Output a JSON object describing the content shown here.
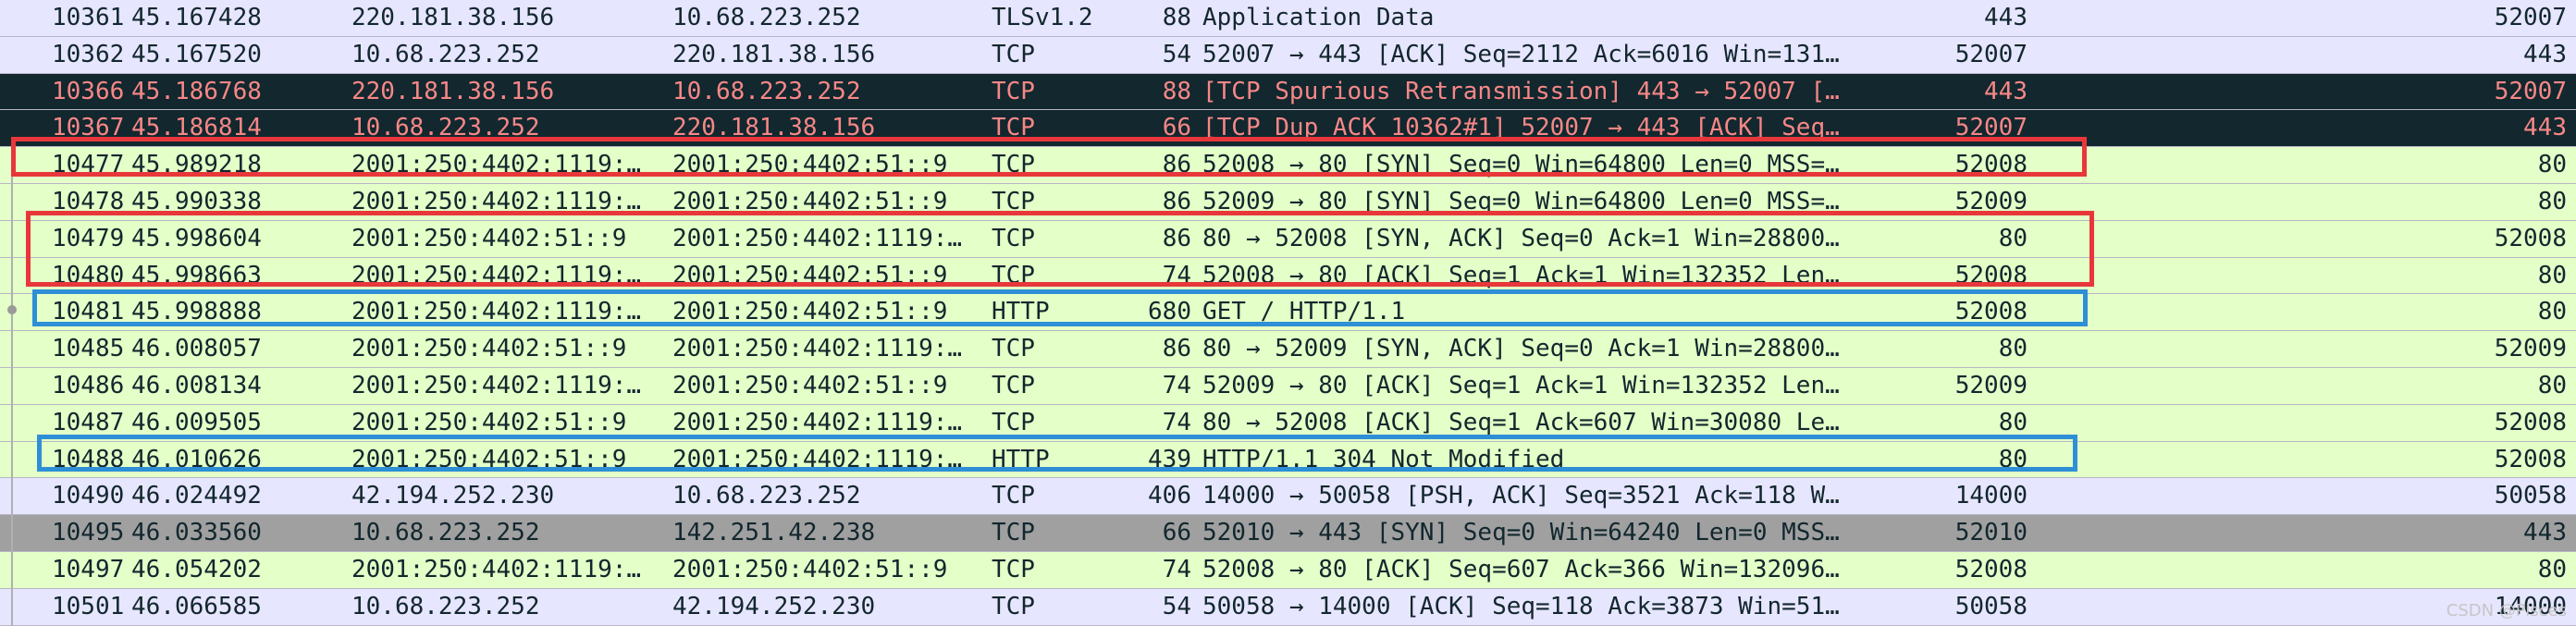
{
  "packets": [
    {
      "no": "10361",
      "time": "45.167428",
      "src": "220.181.38.156",
      "dst": "10.68.223.252",
      "proto": "TLSv1.2",
      "len": "88",
      "info": "Application Data",
      "sport": "443",
      "dport": "52007",
      "style": "tls"
    },
    {
      "no": "10362",
      "time": "45.167520",
      "src": "10.68.223.252",
      "dst": "220.181.38.156",
      "proto": "TCP",
      "len": "54",
      "info": "52007 → 443 [ACK] Seq=2112 Ack=6016 Win=131…",
      "sport": "52007",
      "dport": "443",
      "style": "tcp"
    },
    {
      "no": "10366",
      "time": "45.186768",
      "src": "220.181.38.156",
      "dst": "10.68.223.252",
      "proto": "TCP",
      "len": "88",
      "info": "[TCP Spurious Retransmission] 443 → 52007 […",
      "sport": "443",
      "dport": "52007",
      "style": "bad"
    },
    {
      "no": "10367",
      "time": "45.186814",
      "src": "10.68.223.252",
      "dst": "220.181.38.156",
      "proto": "TCP",
      "len": "66",
      "info": "[TCP Dup ACK 10362#1] 52007 → 443 [ACK] Seq…",
      "sport": "52007",
      "dport": "443",
      "style": "bad"
    },
    {
      "no": "10477",
      "time": "45.989218",
      "src": "2001:250:4402:1119:…",
      "dst": "2001:250:4402:51::9",
      "proto": "TCP",
      "len": "86",
      "info": "52008 → 80 [SYN] Seq=0 Win=64800 Len=0 MSS=…",
      "sport": "52008",
      "dport": "80",
      "style": "http"
    },
    {
      "no": "10478",
      "time": "45.990338",
      "src": "2001:250:4402:1119:…",
      "dst": "2001:250:4402:51::9",
      "proto": "TCP",
      "len": "86",
      "info": "52009 → 80 [SYN] Seq=0 Win=64800 Len=0 MSS=…",
      "sport": "52009",
      "dport": "80",
      "style": "http"
    },
    {
      "no": "10479",
      "time": "45.998604",
      "src": "2001:250:4402:51::9",
      "dst": "2001:250:4402:1119:…",
      "proto": "TCP",
      "len": "86",
      "info": "80 → 52008 [SYN, ACK] Seq=0 Ack=1 Win=28800…",
      "sport": "80",
      "dport": "52008",
      "style": "http"
    },
    {
      "no": "10480",
      "time": "45.998663",
      "src": "2001:250:4402:1119:…",
      "dst": "2001:250:4402:51::9",
      "proto": "TCP",
      "len": "74",
      "info": "52008 → 80 [ACK] Seq=1 Ack=1 Win=132352 Len…",
      "sport": "52008",
      "dport": "80",
      "style": "http"
    },
    {
      "no": "10481",
      "time": "45.998888",
      "src": "2001:250:4402:1119:…",
      "dst": "2001:250:4402:51::9",
      "proto": "HTTP",
      "len": "680",
      "info": "GET / HTTP/1.1",
      "sport": "52008",
      "dport": "80",
      "style": "http"
    },
    {
      "no": "10485",
      "time": "46.008057",
      "src": "2001:250:4402:51::9",
      "dst": "2001:250:4402:1119:…",
      "proto": "TCP",
      "len": "86",
      "info": "80 → 52009 [SYN, ACK] Seq=0 Ack=1 Win=28800…",
      "sport": "80",
      "dport": "52009",
      "style": "http"
    },
    {
      "no": "10486",
      "time": "46.008134",
      "src": "2001:250:4402:1119:…",
      "dst": "2001:250:4402:51::9",
      "proto": "TCP",
      "len": "74",
      "info": "52009 → 80 [ACK] Seq=1 Ack=1 Win=132352 Len…",
      "sport": "52009",
      "dport": "80",
      "style": "http"
    },
    {
      "no": "10487",
      "time": "46.009505",
      "src": "2001:250:4402:51::9",
      "dst": "2001:250:4402:1119:…",
      "proto": "TCP",
      "len": "74",
      "info": "80 → 52008 [ACK] Seq=1 Ack=607 Win=30080 Le…",
      "sport": "80",
      "dport": "52008",
      "style": "http"
    },
    {
      "no": "10488",
      "time": "46.010626",
      "src": "2001:250:4402:51::9",
      "dst": "2001:250:4402:1119:…",
      "proto": "HTTP",
      "len": "439",
      "info": "HTTP/1.1 304 Not Modified",
      "sport": "80",
      "dport": "52008",
      "style": "http"
    },
    {
      "no": "10490",
      "time": "46.024492",
      "src": "42.194.252.230",
      "dst": "10.68.223.252",
      "proto": "TCP",
      "len": "406",
      "info": "14000 → 50058 [PSH, ACK] Seq=3521 Ack=118 W…",
      "sport": "14000",
      "dport": "50058",
      "style": "tcp"
    },
    {
      "no": "10495",
      "time": "46.033560",
      "src": "10.68.223.252",
      "dst": "142.251.42.238",
      "proto": "TCP",
      "len": "66",
      "info": "52010 → 443 [SYN] Seq=0 Win=64240 Len=0 MSS…",
      "sport": "52010",
      "dport": "443",
      "style": "grey"
    },
    {
      "no": "10497",
      "time": "46.054202",
      "src": "2001:250:4402:1119:…",
      "dst": "2001:250:4402:51::9",
      "proto": "TCP",
      "len": "74",
      "info": "52008 → 80 [ACK] Seq=607 Ack=366 Win=132096…",
      "sport": "52008",
      "dport": "80",
      "style": "http"
    },
    {
      "no": "10501",
      "time": "46.066585",
      "src": "10.68.223.252",
      "dst": "42.194.252.230",
      "proto": "TCP",
      "len": "54",
      "info": "50058 → 14000 [ACK] Seq=118 Ack=3873 Win=51…",
      "sport": "50058",
      "dport": "14000",
      "style": "tcp"
    }
  ],
  "watermark": "CSDN @Pisces",
  "colors": {
    "tcp": "#e7e6ff",
    "http": "#e4ffc7",
    "bad_bg": "#12272e",
    "bad_fg": "#f78787",
    "grey": "#a0a0a0",
    "highlight_red": "#e8373a",
    "highlight_blue": "#2f8fd6"
  }
}
